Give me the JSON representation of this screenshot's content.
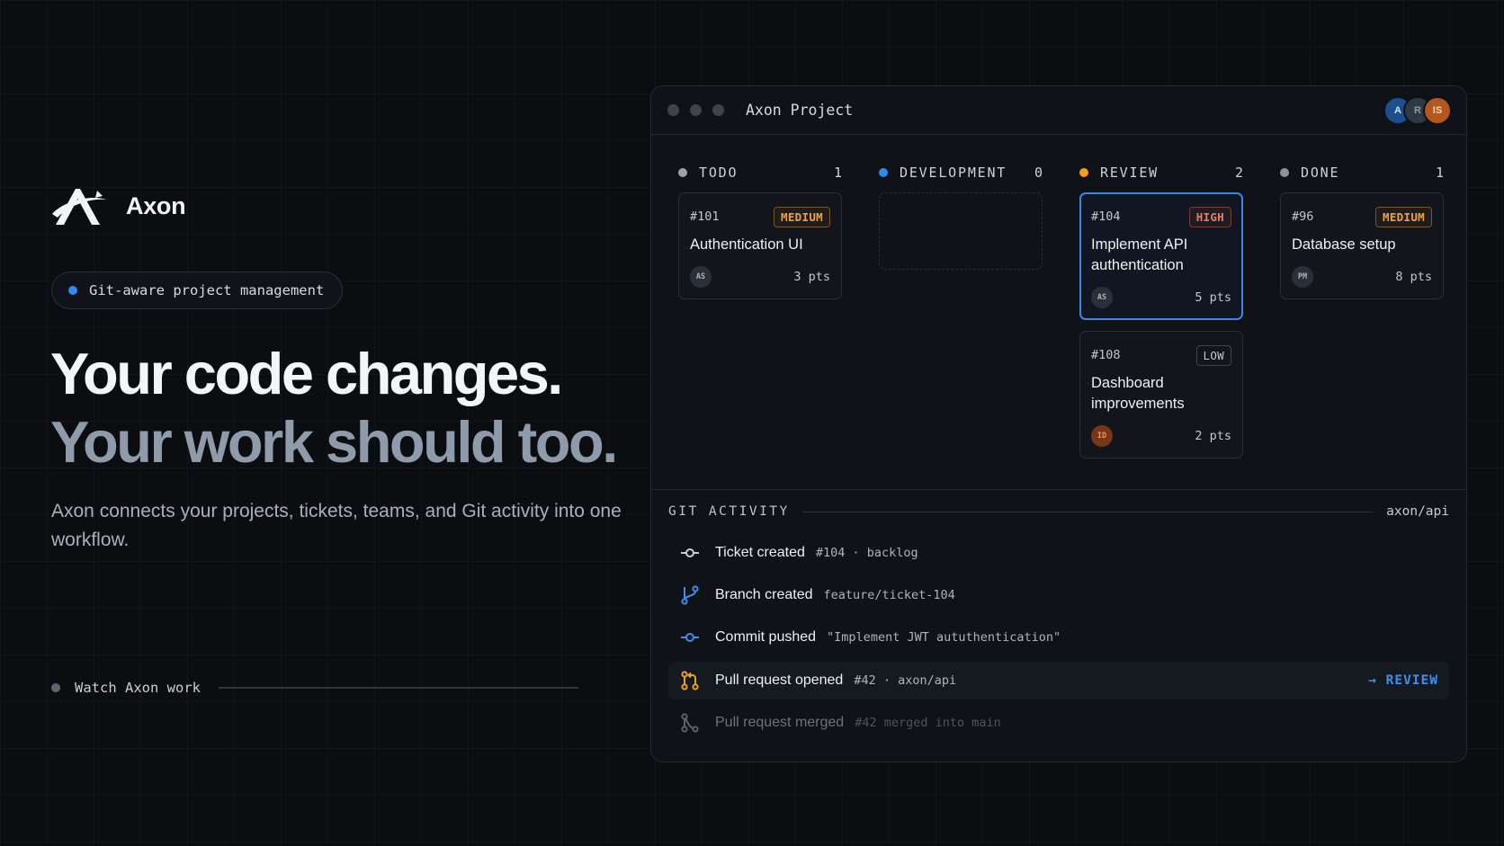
{
  "brand": {
    "name": "Axon"
  },
  "hero": {
    "pill_text": "Git-aware project management",
    "title_line1": "Your code changes.",
    "title_line2": "Your work should too.",
    "subtitle": "Axon connects your projects, tickets, teams, and Git activity into one workflow.",
    "watch_label": "Watch Axon work"
  },
  "window": {
    "title": "Axon Project",
    "avatars": [
      "A",
      "R",
      "IS"
    ]
  },
  "board": {
    "columns": [
      {
        "name": "TODO",
        "count": "1"
      },
      {
        "name": "DEVELOPMENT",
        "count": "0"
      },
      {
        "name": "REVIEW",
        "count": "2"
      },
      {
        "name": "DONE",
        "count": "1"
      }
    ],
    "cards": {
      "c101": {
        "id": "#101",
        "priority": "MEDIUM",
        "title": "Authentication UI",
        "assignee": "AS",
        "points": "3 pts"
      },
      "c104": {
        "id": "#104",
        "priority": "HIGH",
        "title": "Implement API authentication",
        "assignee": "AS",
        "points": "5 pts"
      },
      "c108": {
        "id": "#108",
        "priority": "LOW",
        "title": "Dashboard improvements",
        "assignee": "ID",
        "points": "2 pts"
      },
      "c96": {
        "id": "#96",
        "priority": "MEDIUM",
        "title": "Database setup",
        "assignee": "PM",
        "points": "8 pts"
      }
    }
  },
  "git": {
    "label": "GIT ACTIVITY",
    "repo": "axon/api",
    "activity": [
      {
        "title": "Ticket created",
        "meta": "#104 · backlog",
        "icon": "commit-icon"
      },
      {
        "title": "Branch created",
        "meta": "feature/ticket-104",
        "icon": "branch-icon"
      },
      {
        "title": "Commit pushed",
        "meta": "\"Implement JWT aututhentication\"",
        "icon": "commit-icon"
      },
      {
        "title": "Pull request opened",
        "meta": "#42 · axon/api",
        "tag": "→ REVIEW",
        "icon": "pull-request-icon"
      },
      {
        "title": "Pull request merged",
        "meta": "#42 merged into main",
        "icon": "merge-icon"
      }
    ]
  },
  "colors": {
    "accent_blue": "#2f8bf2",
    "review_orange": "#f0a020",
    "priority_medium": "#f3a23a",
    "priority_high": "#f07a5c"
  }
}
